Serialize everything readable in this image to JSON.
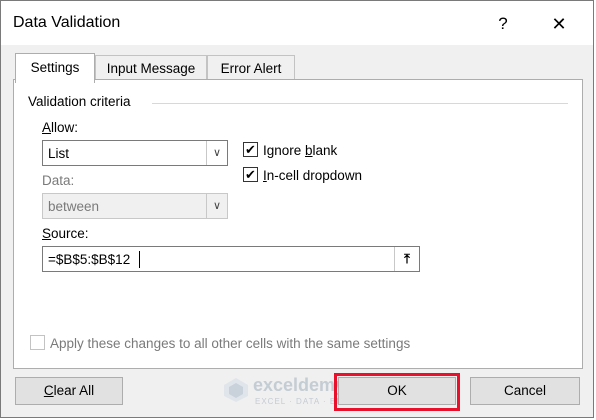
{
  "window": {
    "title": "Data Validation",
    "help_glyph": "?",
    "close_glyph": "✕"
  },
  "tabs": [
    {
      "label": "Settings",
      "active": true
    },
    {
      "label": "Input Message",
      "active": false
    },
    {
      "label": "Error Alert",
      "active": false
    }
  ],
  "settings": {
    "group_label": "Validation criteria",
    "allow": {
      "label_pre": "",
      "label_key": "A",
      "label_post": "llow:",
      "value": "List"
    },
    "data": {
      "label": "Data:",
      "value": "between",
      "disabled": true
    },
    "ignore_blank": {
      "label_pre": "Ignore ",
      "label_key": "b",
      "label_post": "lank",
      "checked": true
    },
    "incell_dropdown": {
      "label_pre": "",
      "label_key": "I",
      "label_post": "n-cell dropdown",
      "checked": true
    },
    "source": {
      "label_pre": "",
      "label_key": "S",
      "label_post": "ource:",
      "value": "=$B$5:$B$12"
    },
    "apply_all": {
      "label": "Apply these changes to all other cells with the same settings",
      "checked": false,
      "disabled": true
    }
  },
  "buttons": {
    "clear_all_pre": "",
    "clear_all_key": "C",
    "clear_all_post": "lear All",
    "ok": "OK",
    "cancel": "Cancel"
  },
  "watermark": {
    "name": "exceldemy",
    "tagline": "EXCEL · DATA · BI"
  },
  "colors": {
    "highlight": "#e8102b",
    "dialog_bg": "#f0f0f0"
  }
}
